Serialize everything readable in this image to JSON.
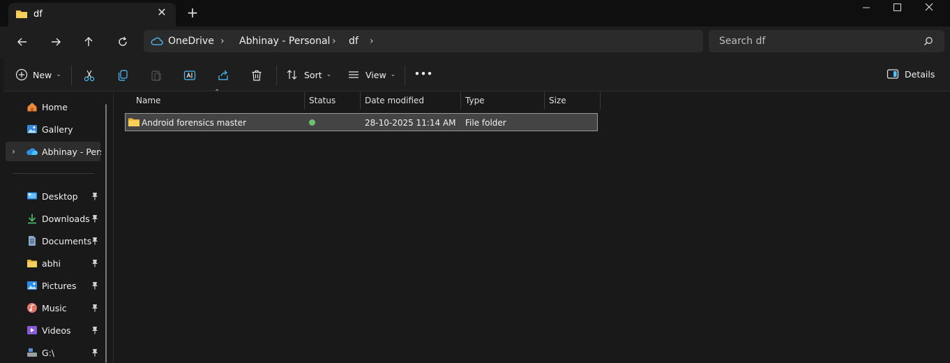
{
  "tab": {
    "title": "df",
    "close": "✕",
    "new_tab": "+"
  },
  "window_controls": {
    "minimize": "—",
    "maximize": "☐",
    "close": "✕"
  },
  "nav": {
    "back": "←",
    "forward": "→",
    "up": "↑",
    "refresh": "↻"
  },
  "breadcrumbs": [
    "OneDrive",
    "Abhinay - Personal",
    "df"
  ],
  "breadcrumb_separator": "›",
  "search": {
    "placeholder": "Search df"
  },
  "toolbar": {
    "new_label": "New",
    "sort_label": "Sort",
    "view_label": "View",
    "more_label": "•••",
    "details_label": "Details"
  },
  "sidebar": {
    "top_items": [
      {
        "label": "Home",
        "icon": "home-icon"
      },
      {
        "label": "Gallery",
        "icon": "gallery-icon"
      },
      {
        "label": "Abhinay - Perso",
        "icon": "onedrive-cloud-icon",
        "expandable": true,
        "selected": true
      }
    ],
    "pinned_items": [
      {
        "label": "Desktop",
        "icon": "desktop-icon"
      },
      {
        "label": "Downloads",
        "icon": "downloads-icon"
      },
      {
        "label": "Documents",
        "icon": "documents-icon"
      },
      {
        "label": "abhi",
        "icon": "folder-icon"
      },
      {
        "label": "Pictures",
        "icon": "pictures-icon"
      },
      {
        "label": "Music",
        "icon": "music-icon"
      },
      {
        "label": "Videos",
        "icon": "videos-icon"
      },
      {
        "label": "G:\\",
        "icon": "drive-icon"
      }
    ]
  },
  "columns": [
    "Name",
    "Status",
    "Date modified",
    "Type",
    "Size"
  ],
  "files": [
    {
      "name": "Android forensics master",
      "status": "synced",
      "date_modified": "28-10-2025 11:14 AM",
      "type": "File folder",
      "size": ""
    }
  ],
  "colors": {
    "accent": "#4cc2ff",
    "folder": "#f0c04a",
    "status_ok": "#6cc070"
  }
}
